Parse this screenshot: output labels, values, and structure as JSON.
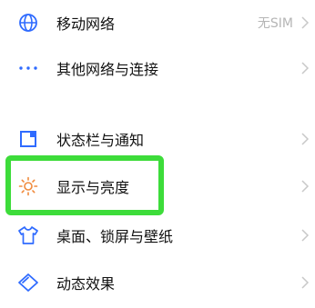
{
  "colors": {
    "icon_blue": "#2f6bff",
    "icon_orange": "#f08a3c",
    "highlight_green": "#3ddc3a",
    "text_primary": "#111111",
    "text_secondary": "#b5b5b5",
    "chevron": "#c8c8c8"
  },
  "settings": {
    "items": [
      {
        "label": "移动网络",
        "value": "无SIM",
        "icon": "globe-icon"
      },
      {
        "label": "其他网络与连接",
        "value": "",
        "icon": "more-dots-icon"
      },
      {
        "label": "状态栏与通知",
        "value": "",
        "icon": "status-bar-icon"
      },
      {
        "label": "显示与亮度",
        "value": "",
        "icon": "sun-icon"
      },
      {
        "label": "桌面、锁屏与壁纸",
        "value": "",
        "icon": "shirt-icon"
      },
      {
        "label": "动态效果",
        "value": "",
        "icon": "diamond-icon"
      }
    ]
  }
}
